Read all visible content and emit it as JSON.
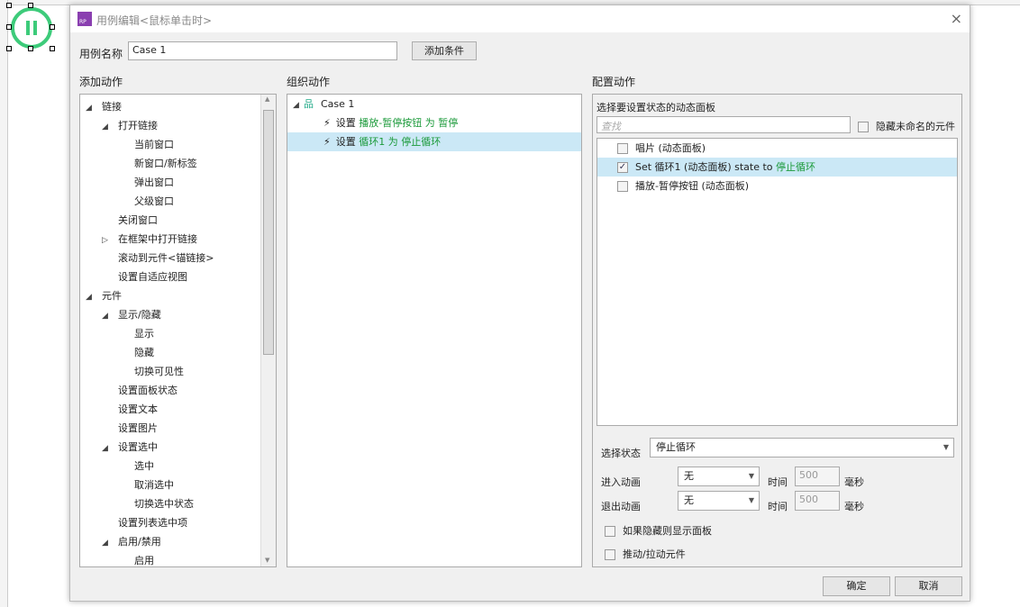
{
  "window": {
    "title": "用例编辑<鼠标单击时>",
    "close": "×"
  },
  "case_name": {
    "label": "用例名称",
    "value": "Case 1",
    "add_condition": "添加条件"
  },
  "add_actions": {
    "heading": "添加动作",
    "items": [
      {
        "label": "链接",
        "level": 0,
        "expand": "open"
      },
      {
        "label": "打开链接",
        "level": 1,
        "expand": "open"
      },
      {
        "label": "当前窗口",
        "level": 2
      },
      {
        "label": "新窗口/新标签",
        "level": 2
      },
      {
        "label": "弹出窗口",
        "level": 2
      },
      {
        "label": "父级窗口",
        "level": 2
      },
      {
        "label": "关闭窗口",
        "level": 1
      },
      {
        "label": "在框架中打开链接",
        "level": 1,
        "expand": "closed"
      },
      {
        "label": "滚动到元件<锚链接>",
        "level": 1
      },
      {
        "label": "设置自适应视图",
        "level": 1
      },
      {
        "label": "元件",
        "level": 0,
        "expand": "open"
      },
      {
        "label": "显示/隐藏",
        "level": 1,
        "expand": "open"
      },
      {
        "label": "显示",
        "level": 2
      },
      {
        "label": "隐藏",
        "level": 2
      },
      {
        "label": "切换可见性",
        "level": 2
      },
      {
        "label": "设置面板状态",
        "level": 1
      },
      {
        "label": "设置文本",
        "level": 1
      },
      {
        "label": "设置图片",
        "level": 1
      },
      {
        "label": "设置选中",
        "level": 1,
        "expand": "open"
      },
      {
        "label": "选中",
        "level": 2
      },
      {
        "label": "取消选中",
        "level": 2
      },
      {
        "label": "切换选中状态",
        "level": 2
      },
      {
        "label": "设置列表选中项",
        "level": 1
      },
      {
        "label": "启用/禁用",
        "level": 1,
        "expand": "open"
      },
      {
        "label": "启用",
        "level": 2
      }
    ]
  },
  "organize": {
    "heading": "组织动作",
    "case": "Case 1",
    "actions": [
      {
        "prefix": "设置 ",
        "target": "播放-暂停按钮 为 暂停",
        "selected": false
      },
      {
        "prefix": "设置 ",
        "target": "循环1 为 停止循环",
        "selected": true
      }
    ]
  },
  "configure": {
    "heading": "配置动作",
    "subheading": "选择要设置状态的动态面板",
    "search_placeholder": "查找",
    "hide_unnamed": "隐藏未命名的元件",
    "panels": [
      {
        "label": "唱片 (动态面板)",
        "checked": false,
        "selected": false
      },
      {
        "label": "Set 循环1 (动态面板) state to ",
        "state": "停止循环",
        "checked": true,
        "selected": true
      },
      {
        "label": "播放-暂停按钮 (动态面板)",
        "checked": false,
        "selected": false
      }
    ],
    "select_state_label": "选择状态",
    "select_state_value": "停止循环",
    "enter_anim_label": "进入动画",
    "enter_anim_value": "无",
    "exit_anim_label": "退出动画",
    "exit_anim_value": "无",
    "time_label": "时间",
    "time_value": "500",
    "ms_label": "毫秒",
    "show_if_hidden": "如果隐藏则显示面板",
    "push_pull": "推动/拉动元件"
  },
  "footer": {
    "ok": "确定",
    "cancel": "取消"
  },
  "colors": {
    "accent_green": "#1b9a3a",
    "selection": "#cbe8f6",
    "widget_green": "#3dcb7a"
  }
}
